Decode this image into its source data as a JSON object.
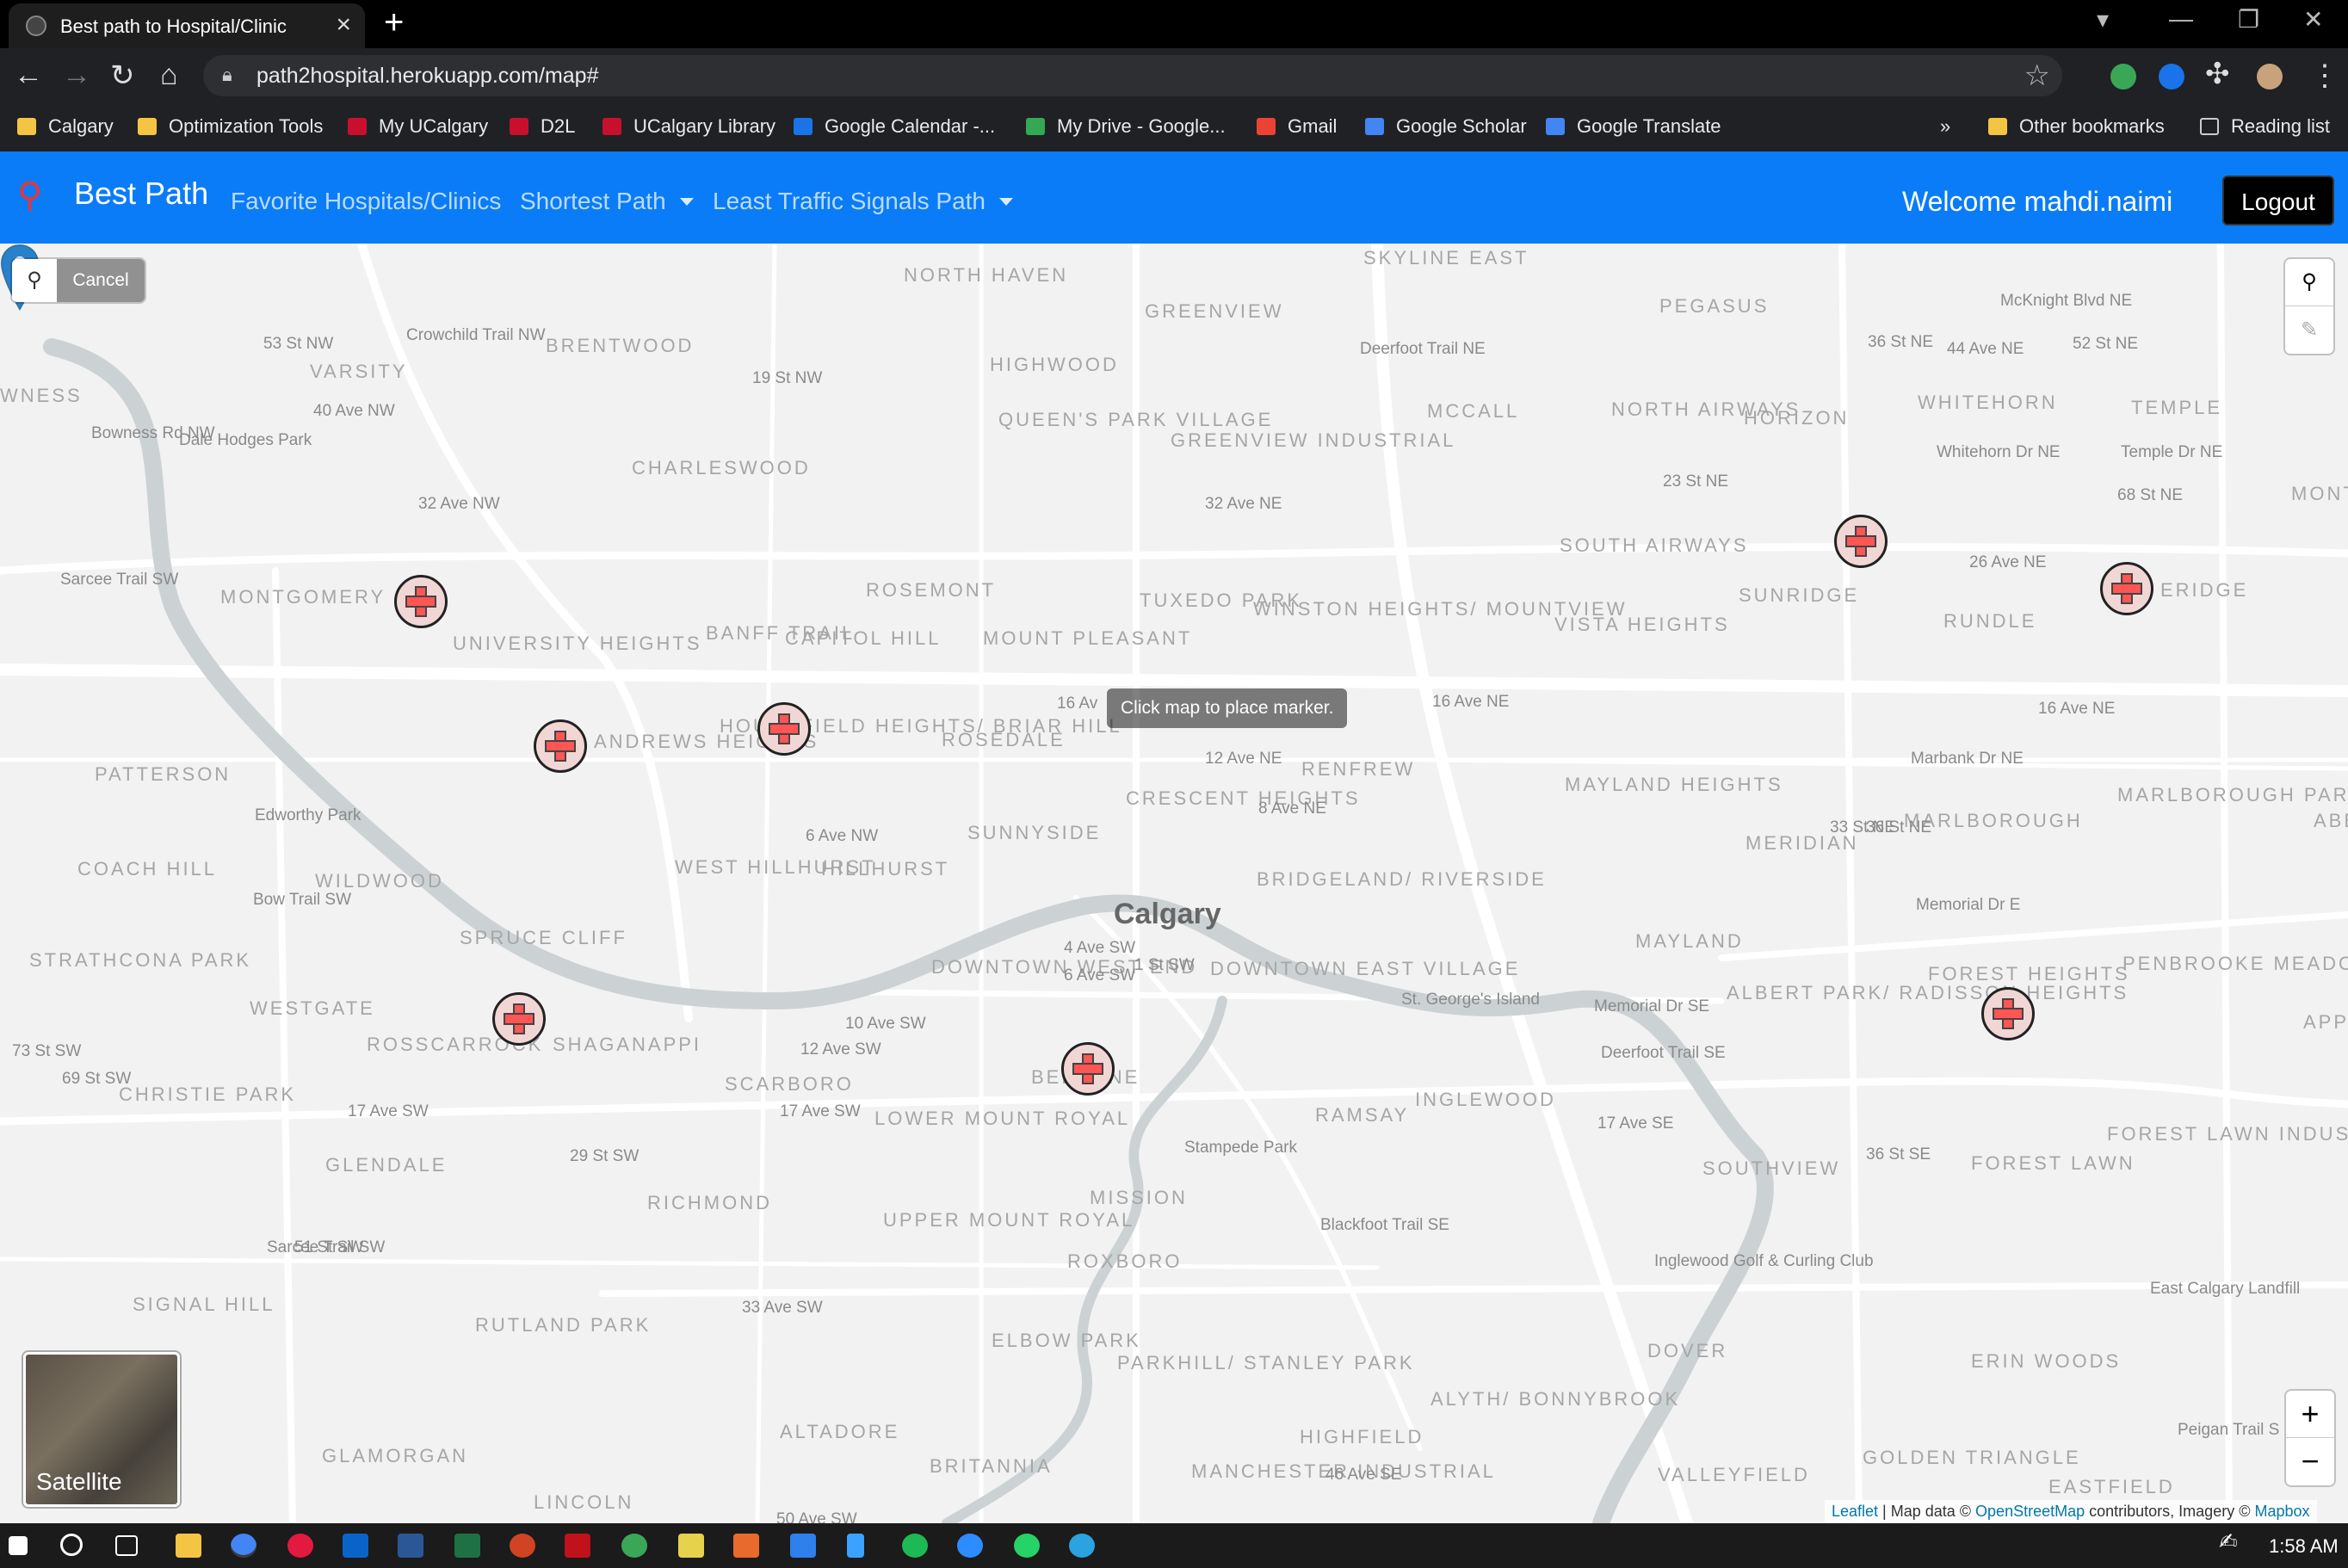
{
  "browser": {
    "tab_title": "Best path to Hospital/Clinic",
    "url": "path2hospital.herokuapp.com/map#",
    "bookmarks": [
      "Calgary",
      "Optimization Tools",
      "My UCalgary",
      "D2L",
      "UCalgary Library",
      "Google Calendar -...",
      "My Drive - Google...",
      "Gmail",
      "Google Scholar",
      "Google Translate"
    ],
    "overflow": "»",
    "other_bookmarks": "Other bookmarks",
    "reading_list": "Reading list"
  },
  "app_nav": {
    "brand": "Best Path",
    "links": [
      "Favorite Hospitals/Clinics",
      "Shortest Path",
      "Least Traffic Signals Path"
    ],
    "welcome": "Welcome mahdi.naimi",
    "logout": "Logout"
  },
  "map": {
    "cancel_label": "Cancel",
    "tooltip": "Click map to place marker.",
    "satellite_label": "Satellite",
    "zoom_in": "+",
    "zoom_out": "−",
    "city_label": "Calgary",
    "neighborhoods": [
      "North Haven",
      "Skyline East",
      "Greenview",
      "Pegasus",
      "Brentwood",
      "Varsity",
      "Highwood",
      "McCall",
      "North Airways",
      "Horizon",
      "Whitehorn",
      "Temple",
      "Queen's Park Village",
      "Greenview Industrial",
      "Charleswood",
      "South Airways",
      "Sunridge",
      "Rundle",
      "Montgomery",
      "University Heights",
      "Rosemont",
      "Tuxedo Park",
      "Banff Trail",
      "Capitol Hill",
      "Mount Pleasant",
      "Winston Heights/ Mountview",
      "Vista Heights",
      "Andrews Heights",
      "Hounsfield Heights/ Briar Hill",
      "Rosedale",
      "Renfrew",
      "Mayland Heights",
      "Marlborough",
      "Marlborough Park",
      "Patterson",
      "Crescent Heights",
      "Meridian",
      "Coach Hill",
      "Wildwood",
      "Sunnyside",
      "West Hillhurst",
      "Hillhurst",
      "Bridgeland/ Riverside",
      "Strathcona Park",
      "Spruce Cliff",
      "Downtown West End",
      "Downtown East Village",
      "Mayland",
      "Albert Park/ Radisson Heights",
      "Forest Heights",
      "Penbrooke Meadows",
      "Westgate",
      "Rosscarrock",
      "Shaganappi",
      "Scarboro",
      "Christie Park",
      "Lower Mount Royal",
      "Ramsay",
      "Inglewood",
      "Southview",
      "Forest Lawn",
      "Forest Lawn Industrial",
      "Glendale",
      "Richmond",
      "Upper Mount Royal",
      "Mission",
      "Roxboro",
      "Signal Hill",
      "Rutland Park",
      "Elbow Park",
      "Parkhill/ Stanley Park",
      "Alyth/ Bonnybrook",
      "Dover",
      "Erin Woods",
      "Altadore",
      "Highfield",
      "Glamorgan",
      "Britannia",
      "Manchester Industrial",
      "Valleyfield",
      "Golden Triangle",
      "Eastfield",
      "Lincoln",
      "Beltline",
      "Apple",
      "Abbey",
      "Mont",
      "Eridge",
      "Wness"
    ],
    "roads": [
      "McKnight Blvd NE",
      "44 Ave NE",
      "Whitehorn Dr NE",
      "Temple Dr NE",
      "32 Ave NE",
      "26 Ave NE",
      "16 Ave NE",
      "16 Ave NE",
      "12 Ave NE",
      "8 Ave NE",
      "Marbank Dr NE",
      "Memorial Dr E",
      "Memorial Dr SE",
      "17 Ave SE",
      "40 Ave NW",
      "32 Ave NW",
      "Dale Hodges Park",
      "Bowness Rd NW",
      "Crowchild Trail NW",
      "53 St NW",
      "19 St NW",
      "Sarcee Trail SW",
      "Edworthy Park",
      "Bow Trail SW",
      "6 Ave NW",
      "10 Ave SW",
      "12 Ave SW",
      "17 Ave SW",
      "17 Ave SW",
      "33 Ave SW",
      "Stampede Park",
      "Blackfoot Trail SE",
      "Deerfoot Trail NE",
      "Deerfoot Trail SE",
      "4 Ave SW",
      "6 Ave SW",
      "St. George's Island",
      "Inglewood Golf & Curling Club",
      "East Calgary Landfill",
      "Peigan Trail S",
      "46 Ave SE",
      "50 Ave SW",
      "36 St NE",
      "52 St NE",
      "23 St NE",
      "33 St NE",
      "36 St NE",
      "36 St SE",
      "73 St SW",
      "69 St SW",
      "29 St SW",
      "Sarcee Trail SW",
      "51 St SW",
      "1 St SW",
      "68 St NE",
      "16 Av"
    ],
    "hospital_marker_count": 9,
    "attribution": {
      "leaflet": "Leaflet",
      "sep": " | Map data © ",
      "osm": "OpenStreetMap",
      "mid": " contributors, Imagery © ",
      "mapbox": "Mapbox"
    }
  },
  "taskbar": {
    "time": "1:58 AM"
  }
}
